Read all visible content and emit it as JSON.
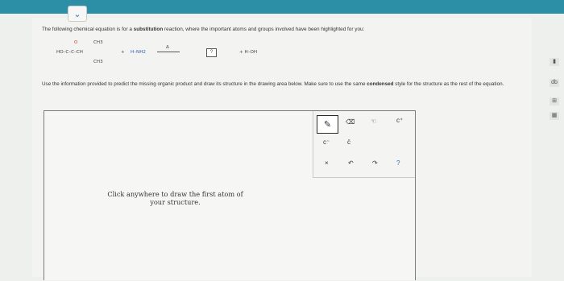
{
  "question": {
    "intro_before": "The following chemical equation is for a ",
    "intro_bold": "substitution",
    "intro_after": " reaction, where the important atoms and groups involved have been highlighted for you:"
  },
  "equation": {
    "ho_c": "HO–C–C–CH",
    "sub3": "3",
    "o_top": "O",
    "ch3_top": "CH3",
    "ch3_bottom": "CH3",
    "plus1": "+",
    "reagent": "H–NH2",
    "heat": "Δ",
    "plus2": "+ H–OH",
    "answer_placeholder": "?"
  },
  "instructions": {
    "text_before": "Use the information provided to predict the missing organic product and draw its structure in the drawing area below. Make sure to use the same ",
    "text_bold": "condensed",
    "text_after": " style for the structure as the rest of the equation."
  },
  "draw": {
    "hint": "Click anywhere to draw the first atom of your structure."
  },
  "palette": {
    "pencil_icon": "✎",
    "eraser_icon": "⌫",
    "hand_icon": "☜",
    "c_plus": "c⁺",
    "c_minus": "c⁻",
    "c_dot": "c̈",
    "x": "×",
    "undo": "↶",
    "redo": "↷",
    "help": "?"
  },
  "sidebar": [
    "▮",
    "db",
    "⊞",
    "▦"
  ],
  "collapse_icon": "⌄"
}
